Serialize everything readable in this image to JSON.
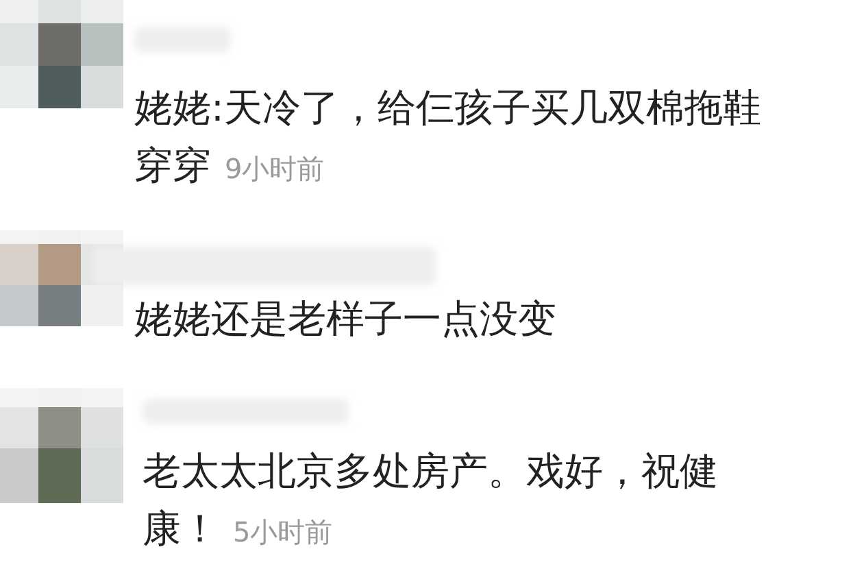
{
  "comments": [
    {
      "lines": [
        "姥姥:天冷了，给仨孩子买几双棉拖鞋",
        "穿穿"
      ],
      "time": "9小时前"
    },
    {
      "lines": [
        "姥姥还是老样子一点没变"
      ]
    },
    {
      "lines": [
        "老太太北京多处房产。戏好，祝健",
        "康！"
      ],
      "time": "5小时前"
    }
  ]
}
